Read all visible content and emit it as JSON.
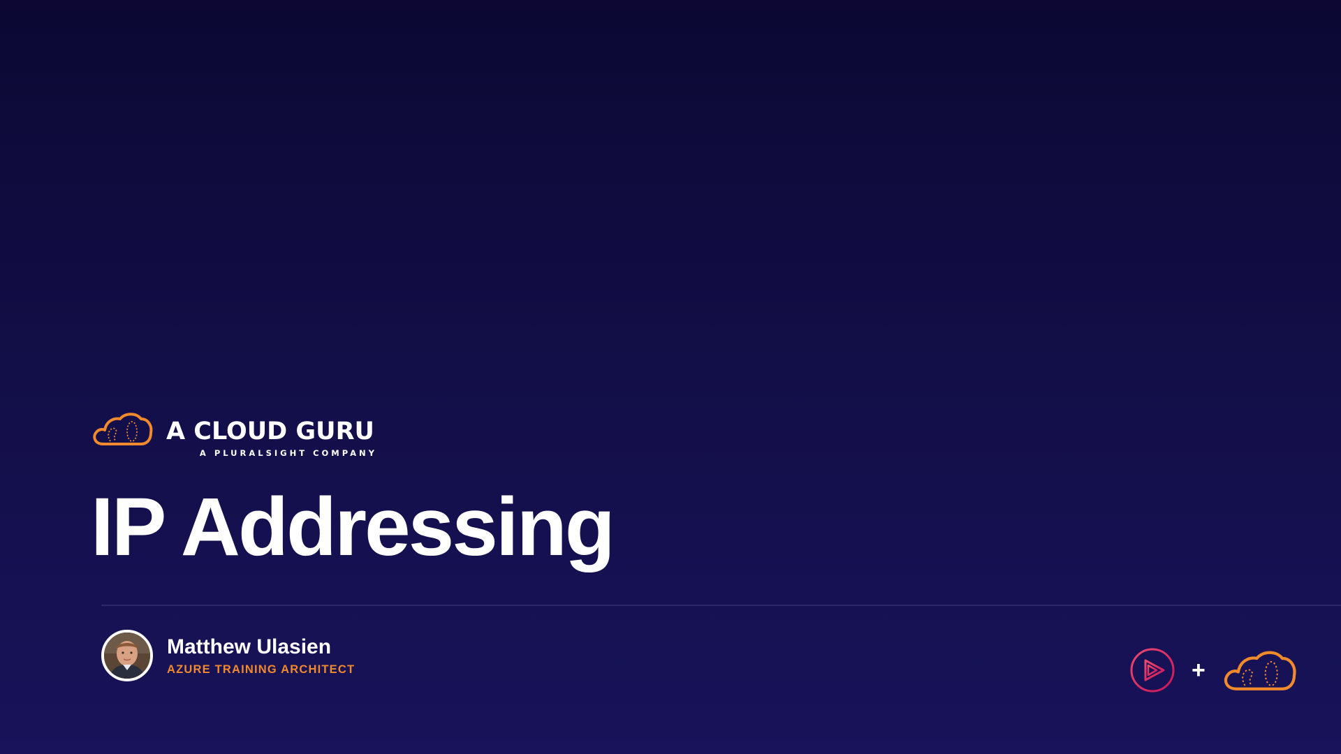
{
  "brand": {
    "name": "A CLOUD GURU",
    "subtitle": "A PLURALSIGHT COMPANY",
    "logo_icon": "cloud-logo-icon",
    "accent_color": "#f08a2c"
  },
  "slide": {
    "title": "IP Addressing"
  },
  "presenter": {
    "name": "Matthew Ulasien",
    "role": "AZURE TRAINING ARCHITECT",
    "avatar_icon": "presenter-avatar"
  },
  "footer": {
    "left_logo_icon": "pluralsight-play-icon",
    "plus_sign": "+",
    "right_logo_icon": "cloud-logo-icon",
    "pluralsight_color": "#e0245e"
  },
  "colors": {
    "background_top": "#0c0833",
    "background_bottom": "#18135a",
    "divider": "#2c2a6a"
  }
}
